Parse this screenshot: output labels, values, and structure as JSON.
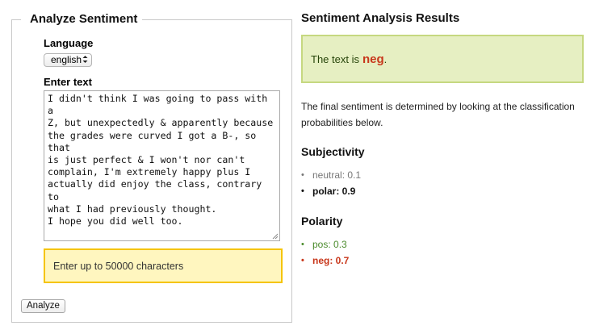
{
  "form": {
    "legend": "Analyze Sentiment",
    "language_label": "Language",
    "language_value": "english",
    "text_label": "Enter text",
    "text_value": "I didn't think I was going to pass with a\nZ, but unexpectedly & apparently because\nthe grades were curved I got a B-, so that\nis just perfect & I won't nor can't\ncomplain, I'm extremely happy plus I\nactually did enjoy the class, contrary to\nwhat I had previously thought.\nI hope you did well too.",
    "hint": "Enter up to 50000 characters",
    "submit_label": "Analyze"
  },
  "results": {
    "title": "Sentiment Analysis Results",
    "summary_prefix": "The text is",
    "summary_value": "neg",
    "summary_suffix": ".",
    "explanation": "The final sentiment is determined by looking at the classification probabilities below.",
    "subjectivity": {
      "heading": "Subjectivity",
      "items": [
        {
          "text": "neutral: 0.1"
        },
        {
          "text": "polar: 0.9"
        }
      ]
    },
    "polarity": {
      "heading": "Polarity",
      "items": [
        {
          "text": "pos: 0.3"
        },
        {
          "text": "neg: 0.7"
        }
      ]
    }
  },
  "colors": {
    "result_bg": "#e6efc2",
    "result_border": "#c6d880",
    "hint_bg": "#fff6bf",
    "hint_border": "#f5c400",
    "negative": "#c8371b",
    "positive": "#4a8b2b"
  },
  "icons": {
    "select_arrows": "up-down-chevron-icon",
    "resize_grip": "resize-grip-icon"
  }
}
